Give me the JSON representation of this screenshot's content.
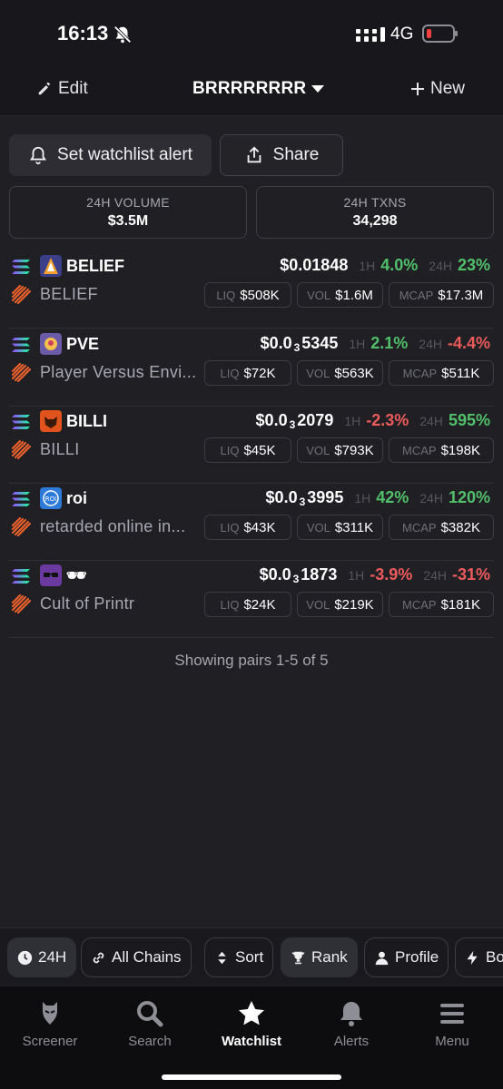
{
  "status_bar": {
    "time": "16:13",
    "network": "4G"
  },
  "header": {
    "edit_label": "Edit",
    "watchlist_name": "BRRRRRRRR",
    "new_label": "New"
  },
  "actions": {
    "alert_label": "Set watchlist alert",
    "share_label": "Share"
  },
  "stats": [
    {
      "label": "24H VOLUME",
      "value": "$3.5M"
    },
    {
      "label": "24H TXNS",
      "value": "34,298"
    }
  ],
  "pairs": [
    {
      "symbol": "BELIEF",
      "name": "BELIEF",
      "price_main": "$0.01848",
      "price_sub": "",
      "price_tail": "",
      "h1_label": "1H",
      "h1": "4.0%",
      "h24_label": "24H",
      "h24": "23%",
      "liq": "$508K",
      "vol": "$1.6M",
      "mcap": "$17.3M"
    },
    {
      "symbol": "PVE",
      "name": "Player Versus Envi...",
      "price_main": "$0.0",
      "price_sub": "3",
      "price_tail": "5345",
      "h1_label": "1H",
      "h1": "2.1%",
      "h24_label": "24H",
      "h24": "-4.4%",
      "liq": "$72K",
      "vol": "$563K",
      "mcap": "$511K"
    },
    {
      "symbol": "BILLI",
      "name": "BILLI",
      "price_main": "$0.0",
      "price_sub": "3",
      "price_tail": "2079",
      "h1_label": "1H",
      "h1": "-2.3%",
      "h24_label": "24H",
      "h24": "595%",
      "liq": "$45K",
      "vol": "$793K",
      "mcap": "$198K"
    },
    {
      "symbol": "roi",
      "name": "retarded online in...",
      "price_main": "$0.0",
      "price_sub": "3",
      "price_tail": "3995",
      "h1_label": "1H",
      "h1": "42%",
      "h24_label": "24H",
      "h24": "120%",
      "liq": "$43K",
      "vol": "$311K",
      "mcap": "$382K"
    },
    {
      "symbol": "🕶",
      "name": "Cult of Printr",
      "price_main": "$0.0",
      "price_sub": "3",
      "price_tail": "1873",
      "h1_label": "1H",
      "h1": "-3.9%",
      "h24_label": "24H",
      "h24": "-31%",
      "liq": "$24K",
      "vol": "$219K",
      "mcap": "$181K"
    }
  ],
  "pill_labels": {
    "liq": "LIQ",
    "vol": "VOL",
    "mcap": "MCAP"
  },
  "showing_text": "Showing pairs 1-5 of 5",
  "filters": {
    "time": "24H",
    "chains": "All Chains",
    "sort": "Sort",
    "rank": "Rank",
    "profile": "Profile",
    "boosts": "Bo"
  },
  "tabs": {
    "screener": "Screener",
    "search": "Search",
    "watchlist": "Watchlist",
    "alerts": "Alerts",
    "menu": "Menu"
  },
  "colors": {
    "up": "#52c06a",
    "down": "#ec5b5b",
    "background": "#1f1f24"
  }
}
